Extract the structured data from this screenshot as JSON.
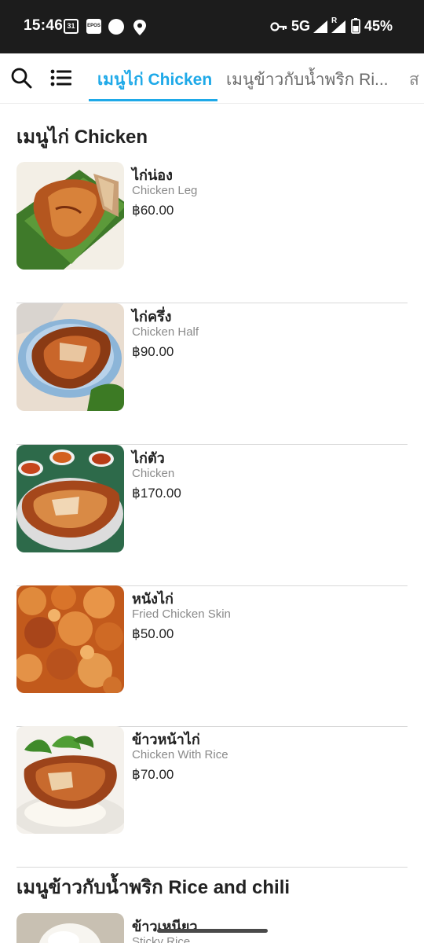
{
  "status_bar": {
    "time": "15:46",
    "calendar_day": "31",
    "epos_label": "EPOS",
    "network": "5G",
    "roaming": "R",
    "battery": "45%"
  },
  "tabs": {
    "active": "เมนูไก่ Chicken",
    "second": "เมนูข้าวกับน้ำพริก Ri...",
    "third": "ส"
  },
  "sections": [
    {
      "title": "เมนูไก่ Chicken",
      "items": [
        {
          "name_th": "ไก่น่อง",
          "name_en": "Chicken Leg",
          "price": "฿60.00"
        },
        {
          "name_th": "ไก่ครึ่ง",
          "name_en": "Chicken Half",
          "price": "฿90.00"
        },
        {
          "name_th": "ไก่ตัว",
          "name_en": "Chicken",
          "price": "฿170.00"
        },
        {
          "name_th": "หนังไก่",
          "name_en": "Fried Chicken Skin",
          "price": "฿50.00"
        },
        {
          "name_th": "ข้าวหน้าไก่",
          "name_en": "Chicken With Rice",
          "price": "฿70.00"
        }
      ]
    },
    {
      "title": "เมนูข้าวกับน้ำพริก Rice and chili",
      "items": [
        {
          "name_th": "ข้าวเหนียว",
          "name_en": "Sticky Rice"
        }
      ]
    }
  ],
  "colors": {
    "accent": "#1ea9e8",
    "status_bar": "#1c1c1c",
    "divider": "#d9d9d9"
  }
}
